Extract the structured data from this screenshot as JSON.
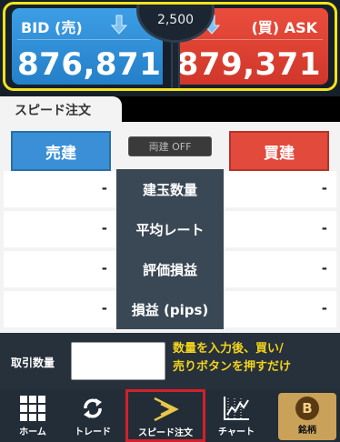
{
  "quote": {
    "bid_label": "BID (売)",
    "bid_price": "876,871",
    "ask_label": "(買) ASK",
    "ask_price": "879,371",
    "spread": "2,500",
    "colors": {
      "bid": "#2f8fdc",
      "ask": "#e04433",
      "highlight_frame": "#f6e21b"
    }
  },
  "speed_order": {
    "tab_label": "スピード注文",
    "sell_button": "売建",
    "buy_button": "買建",
    "hedge_toggle": "両建 OFF",
    "rows": [
      {
        "label": "建玉数量",
        "sell_value": "-",
        "buy_value": "-"
      },
      {
        "label": "平均レート",
        "sell_value": "-",
        "buy_value": "-"
      },
      {
        "label": "評価損益",
        "sell_value": "-",
        "buy_value": "-"
      },
      {
        "label": "損益 (pips)",
        "sell_value": "-",
        "buy_value": "-"
      }
    ]
  },
  "quantity": {
    "label": "取引数量",
    "value": "",
    "hint_line1": "数量を入力後、買い/",
    "hint_line2": "売りボタンを押すだけ"
  },
  "bottom_nav": {
    "items": [
      {
        "label": "ホーム",
        "icon": "grid-icon"
      },
      {
        "label": "トレード",
        "icon": "refresh-arrows-icon"
      },
      {
        "label": "スピード注文",
        "icon": "chevron-speed-icon",
        "selected": true
      },
      {
        "label": "チャート",
        "icon": "chart-icon"
      },
      {
        "label": "銘柄",
        "icon": "bitcoin-icon",
        "badge_text": "B"
      }
    ]
  }
}
